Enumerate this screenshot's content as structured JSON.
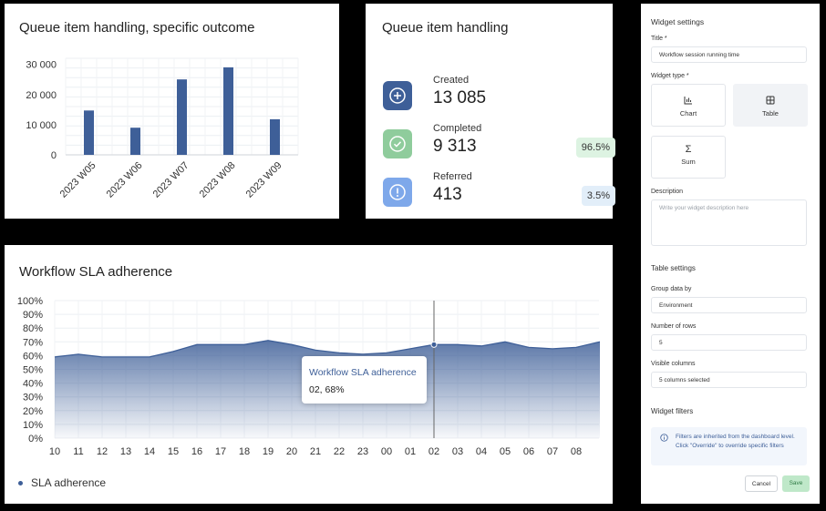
{
  "bar_card": {
    "title": "Queue item handling, specific outcome"
  },
  "stats_card": {
    "title": "Queue item handling",
    "items": [
      {
        "label": "Created",
        "value": "13 085",
        "badge": "",
        "icon": "plus-circle-icon",
        "color": "#3e5f98"
      },
      {
        "label": "Completed",
        "value": "9 313",
        "badge": "96.5%",
        "icon": "check-circle-icon",
        "color": "#8fcc9c"
      },
      {
        "label": "Referred",
        "value": "413",
        "badge": "3.5%",
        "icon": "alert-circle-icon",
        "color": "#7ea8ea"
      }
    ]
  },
  "sla_card": {
    "title": "Workflow SLA adherence"
  },
  "side_panel": {
    "header": "Widget settings",
    "title_label": "Title *",
    "title_value": "Workflow session running time",
    "type_label": "Widget type *",
    "types": [
      {
        "label": "Chart",
        "icon": "bar-chart-icon"
      },
      {
        "label": "Table",
        "icon": "table-icon",
        "selected": true
      },
      {
        "label": "Sum",
        "icon": "sigma-icon"
      }
    ],
    "description_label": "Description",
    "description_placeholder": "Write your widget description here",
    "table_settings_header": "Table settings",
    "group_label": "Group data by",
    "group_value": "Environment",
    "rows_label": "Number of rows",
    "rows_value": "5",
    "columns_label": "Visible columns",
    "columns_value": "5 columns selected",
    "filters_header": "Widget filters",
    "filters_info": "Filters are inherited from the dashboard level. Click \"Override\" to override specific filters",
    "cancel_label": "Cancel",
    "save_label": "Save"
  },
  "chart_data": [
    {
      "type": "bar",
      "categories": [
        "2023 W05",
        "2023 W06",
        "2023 W07",
        "2023 W08",
        "2023 W09"
      ],
      "values": [
        14700,
        9000,
        25000,
        29000,
        11800
      ],
      "y_ticks": [
        "0",
        "10 000",
        "20 000",
        "30 000"
      ],
      "ylim": [
        0,
        32000
      ],
      "color": "#3e5f98"
    },
    {
      "type": "area",
      "title": "Workflow SLA adherence",
      "x": [
        "10",
        "11",
        "12",
        "13",
        "14",
        "15",
        "16",
        "17",
        "18",
        "19",
        "20",
        "21",
        "22",
        "23",
        "00",
        "01",
        "02",
        "03",
        "04",
        "05",
        "06",
        "07",
        "08"
      ],
      "series": [
        {
          "name": "SLA adherence",
          "values": [
            59,
            61,
            59,
            59,
            59,
            63,
            68,
            68,
            68,
            71,
            68,
            64,
            62,
            61,
            62,
            65,
            68,
            68,
            67,
            70,
            66,
            65,
            66,
            70
          ]
        }
      ],
      "y_ticks": [
        "0%",
        "10%",
        "20%",
        "30%",
        "40%",
        "50%",
        "60%",
        "70%",
        "80%",
        "90%",
        "100%"
      ],
      "ylim": [
        0,
        100
      ],
      "color": "#3e5f98",
      "tooltip": {
        "title": "Workflow SLA adherence",
        "text": "02, 68%"
      }
    }
  ]
}
